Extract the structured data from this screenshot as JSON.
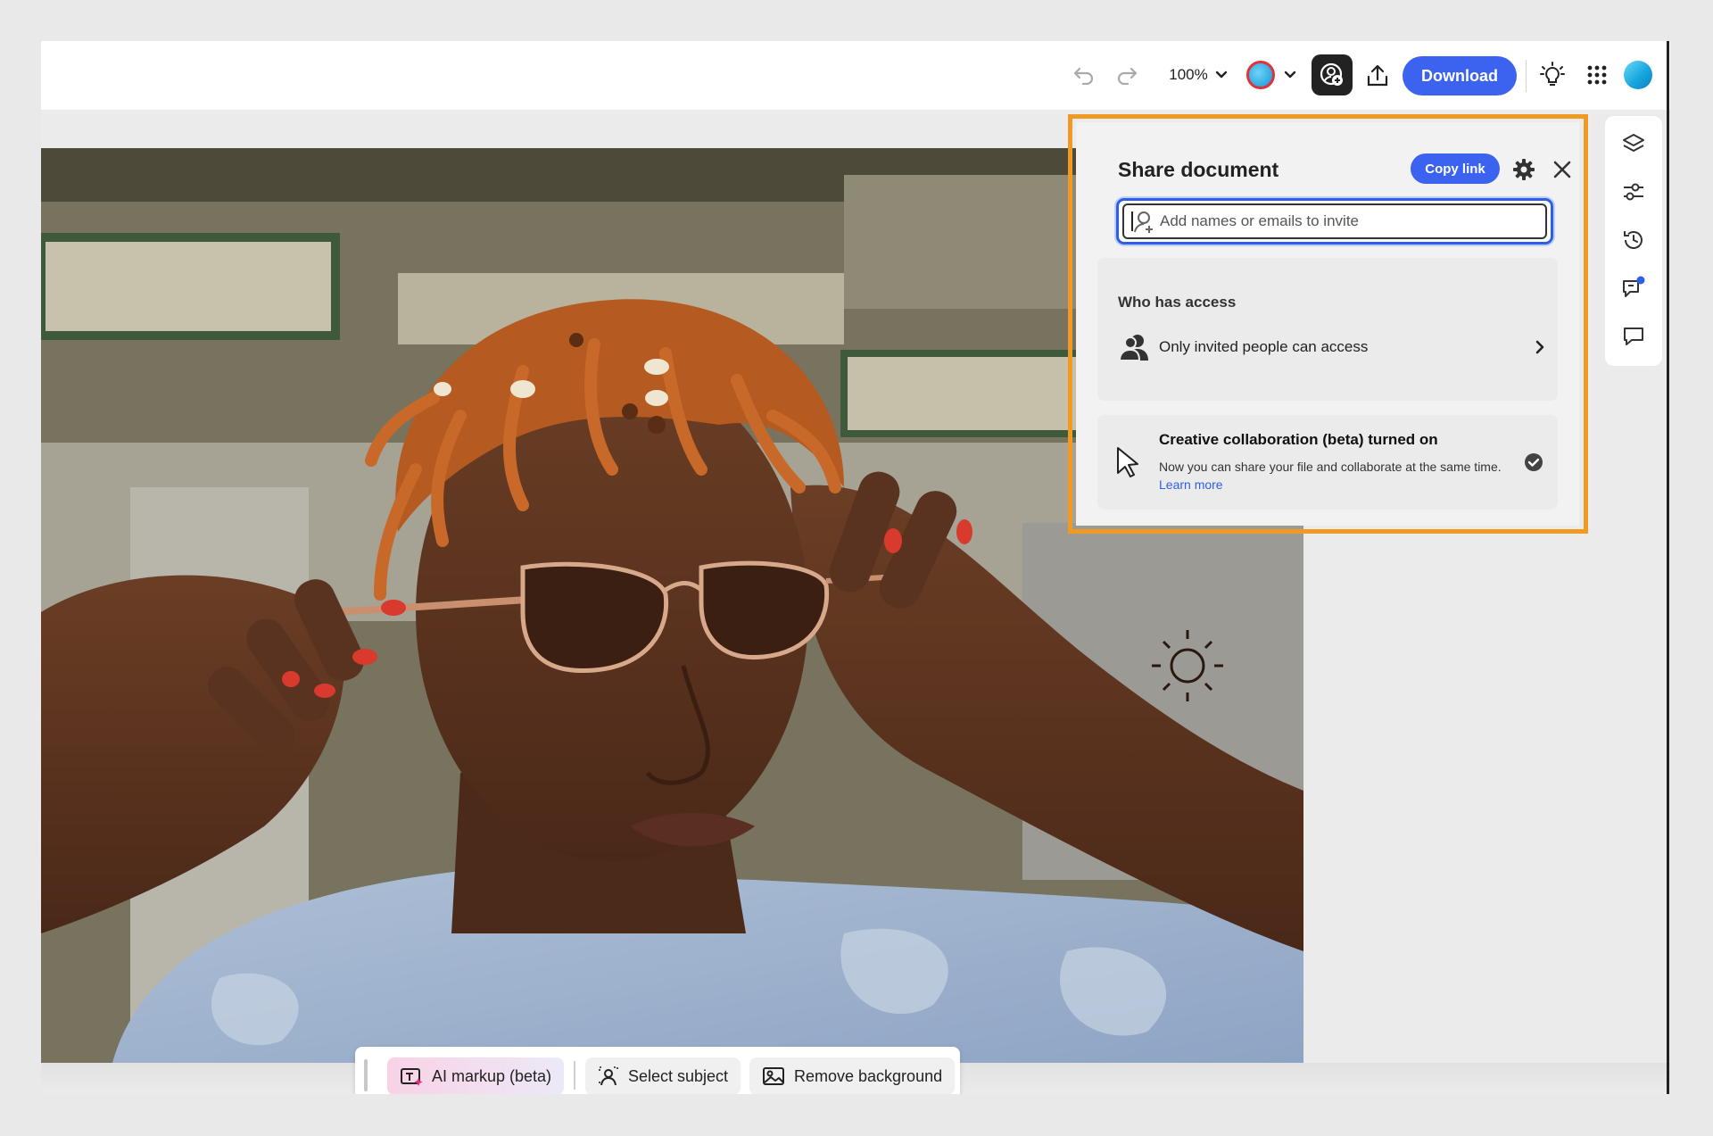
{
  "topbar": {
    "zoom_label": "100%",
    "download_label": "Download",
    "accent_color": "#3b63f0",
    "icons": [
      "undo-icon",
      "redo-icon",
      "chevron-down-icon",
      "color-swatch-icon",
      "share-collaborate-icon",
      "upload-icon",
      "lightbulb-icon",
      "app-grid-icon",
      "user-avatar"
    ]
  },
  "share_panel": {
    "title": "Share document",
    "copy_link_label": "Copy link",
    "invite_placeholder": "Add names or emails to invite",
    "who_has_access_heading": "Who has access",
    "access_option": "Only invited people can access",
    "collab_title": "Creative collaboration (beta) turned on",
    "collab_description": "Now you can share your file and collaborate at the same time.",
    "collab_link": "Learn more",
    "highlight_color": "#f09a23"
  },
  "side_rail": {
    "icons": [
      "layers-icon",
      "adjustments-icon",
      "history-icon",
      "comments-notification-icon",
      "comment-icon"
    ]
  },
  "bottom_toolbar": {
    "ai_markup_label": "AI markup (beta)",
    "select_subject_label": "Select subject",
    "remove_background_label": "Remove background"
  }
}
